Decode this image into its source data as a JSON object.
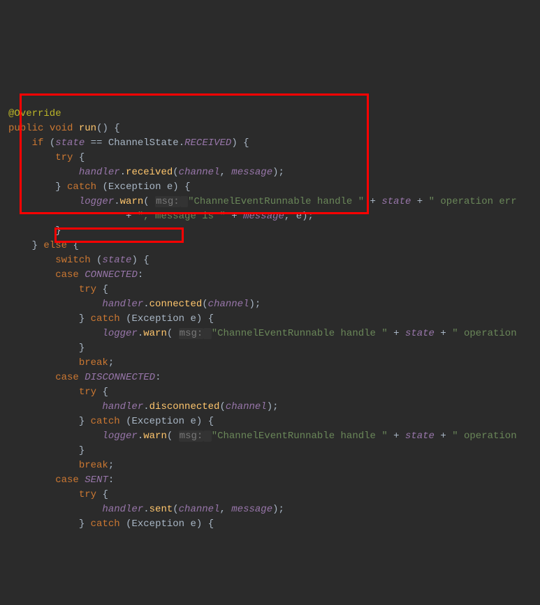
{
  "code": {
    "annotation": "@Override",
    "modifier_public": "public",
    "modifier_void": "void",
    "method_name": "run",
    "kw_if": "if",
    "var_state": "state",
    "op_eq": "==",
    "class_channel_state": "ChannelState",
    "enum_received": "RECEIVED",
    "kw_try": "try",
    "field_handler": "handler",
    "call_received": "received",
    "arg_channel": "channel",
    "arg_message": "message",
    "kw_catch": "catch",
    "type_exception": "Exception",
    "var_e": "e",
    "field_logger": "logger",
    "call_warn": "warn",
    "hint_msg_label": "msg:",
    "str_handle1": "\"ChannelEventRunnable handle \"",
    "op_plus": "+",
    "str_operation_err": "\" operation err",
    "str_msg_is": "\", message is \"",
    "kw_else": "else",
    "kw_switch": "switch",
    "kw_case": "case",
    "enum_connected": "CONNECTED",
    "call_connected": "connected",
    "str_operation": "\" operation",
    "kw_break": "break",
    "enum_disconnected": "DISCONNECTED",
    "call_disconnected": "disconnected",
    "enum_sent": "SENT",
    "call_sent": "sent"
  }
}
